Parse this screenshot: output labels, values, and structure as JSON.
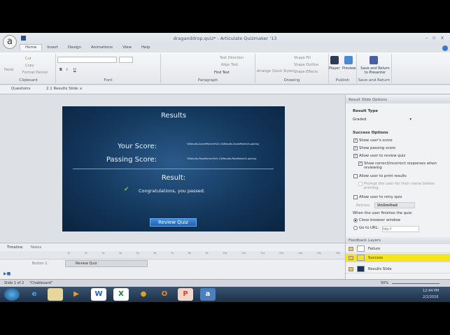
{
  "window": {
    "title": "draganddrop.quiz* - Articulate Quizmaker '13",
    "logo": "a",
    "minimize": "–",
    "maximize": "▫",
    "close": "x"
  },
  "ribbon_tabs": [
    "Home",
    "Insert",
    "Design",
    "Animations",
    "View",
    "Help"
  ],
  "ribbon": {
    "clipboard": {
      "label": "Clipboard",
      "paste": "Paste",
      "cut": "Cut",
      "copy": "Copy",
      "format_painter": "Format Painter"
    },
    "font": {
      "label": "Font",
      "bold": "B",
      "italic": "I",
      "underline": "U"
    },
    "paragraph": {
      "label": "Paragraph",
      "text_direction": "Text Direction",
      "align_text": "Align Text",
      "find_text": "Find Text"
    },
    "drawing": {
      "label": "Drawing",
      "arrange": "Arrange",
      "quick_styles": "Quick Styles",
      "shape_fill": "Shape Fill",
      "shape_outline": "Shape Outline",
      "shape_effects": "Shape Effects"
    },
    "publish": {
      "label": "Publish",
      "player": "Player",
      "preview": "Preview"
    },
    "save_return": {
      "label": "Save and Return",
      "button": "Save and Return to Presenter"
    }
  },
  "doc_tabs": {
    "questions": "Questions",
    "results": "2.1 Results Slide",
    "close": "x"
  },
  "slide": {
    "title": "Results",
    "your_score_label": "Your Score:",
    "your_score_value": "%Results.ScorePercent%% (%Results.ScorePoints% points)",
    "passing_label": "Passing Score:",
    "passing_value": "%Results.PassPercent%% (%Results.PassPoints% points)",
    "result_label": "Result:",
    "message": "Congratulations, you passed.",
    "review_button": "Review Quiz"
  },
  "panel": {
    "header": "Result Slide Options",
    "result_type_label": "Result Type",
    "result_type_value": "Graded",
    "success_options_label": "Success Options",
    "options": [
      {
        "label": "Show user's score",
        "checked": true
      },
      {
        "label": "Show passing score",
        "checked": true
      },
      {
        "label": "Allow user to review quiz",
        "checked": true
      },
      {
        "label": "Show correct/incorrect responses when reviewing",
        "checked": true
      },
      {
        "label": "Allow user to print results",
        "checked": false
      },
      {
        "label": "Prompt the user for their name before printing",
        "checked": false
      },
      {
        "label": "Allow user to retry quiz",
        "checked": false
      }
    ],
    "retries_label": "Retries:",
    "retries_value": "Unlimited",
    "finish_label": "When the user finishes the quiz:",
    "close_browser": "Close browser window",
    "goto_url": "Go to URL:",
    "url_placeholder": "http://"
  },
  "layers": {
    "header": "Feedback Layers",
    "items": [
      "Failure",
      "Success",
      "Results Slide"
    ],
    "highlight": "#f5e51e"
  },
  "timeline": {
    "tabs": [
      "Timeline",
      "Notes"
    ],
    "rows": [
      "",
      "Button 1"
    ],
    "bar_label": "Review Quiz",
    "ticks": [
      "1s",
      "2s",
      "3s",
      "4s",
      "5s",
      "6s",
      "7s",
      "8s",
      "9s",
      "10s",
      "11s",
      "12s",
      "13s",
      "14s",
      "15s",
      "16s"
    ]
  },
  "status": {
    "slide": "Slide 1 of 2",
    "theme": "\"Chalkboard\"",
    "zoom": "50%"
  },
  "taskbar": {
    "time": "12:44 PM",
    "date": "2/2/2016"
  }
}
